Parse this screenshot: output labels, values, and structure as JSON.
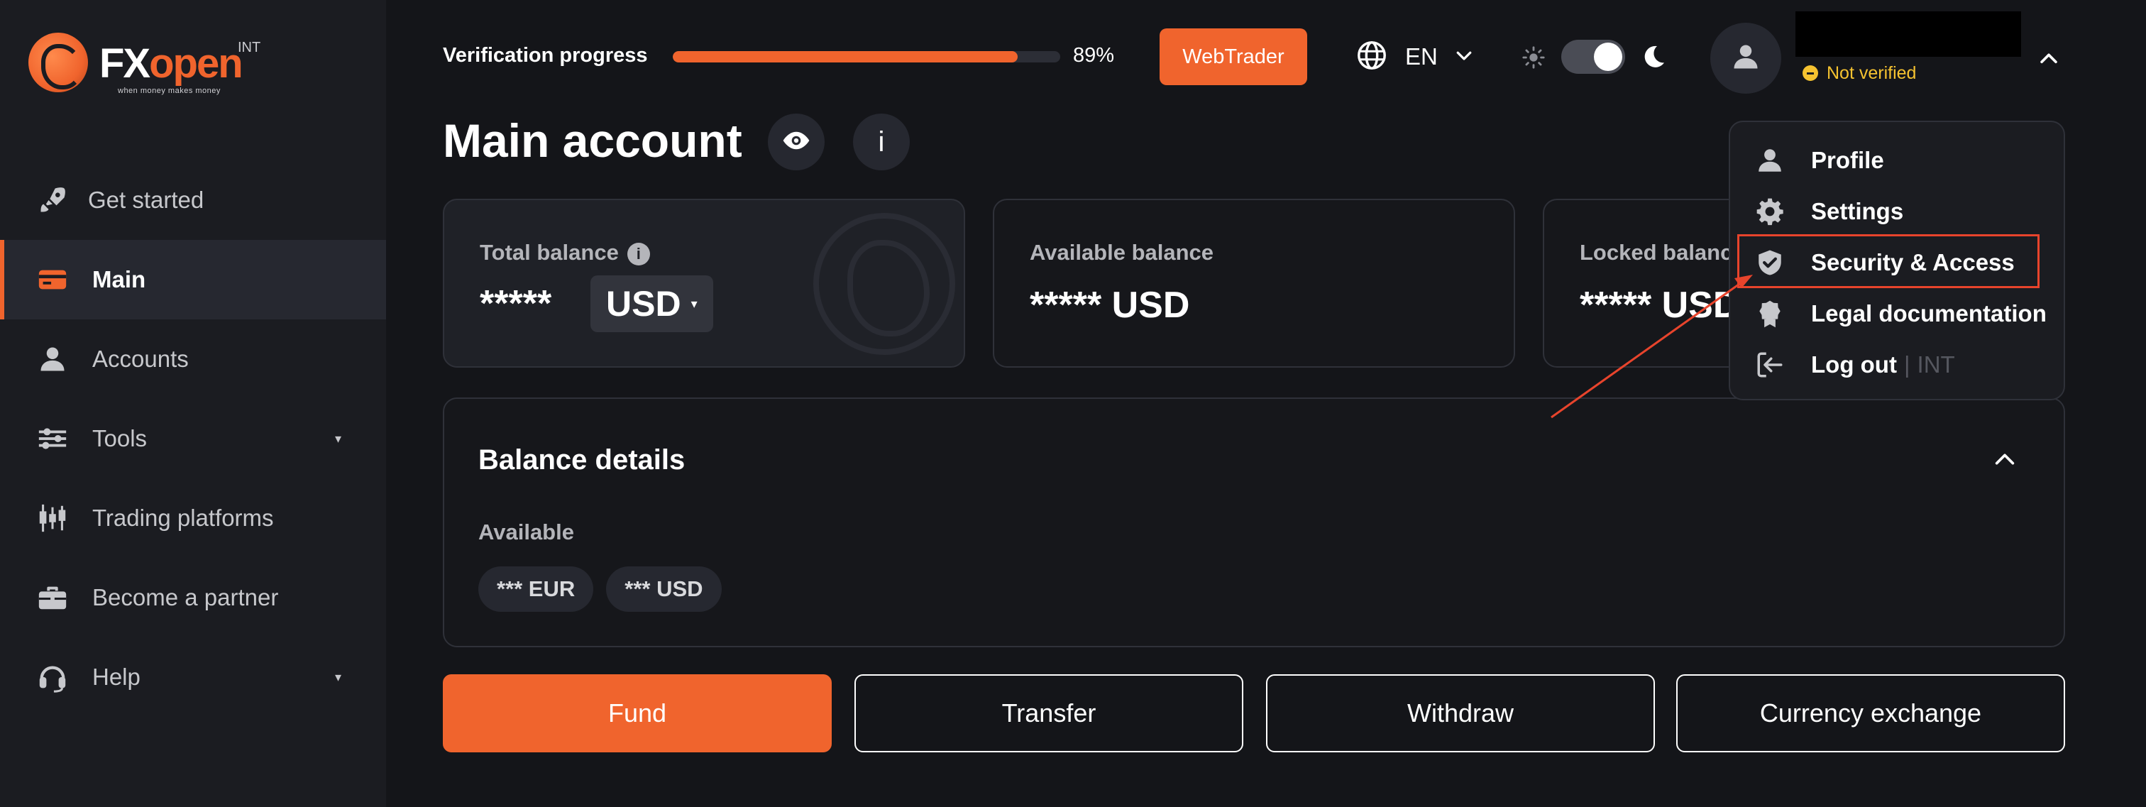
{
  "brand": {
    "logo_fx": "FX",
    "logo_open": "open",
    "logo_suffix": "INT",
    "tagline": "when money makes money"
  },
  "sidebar": {
    "items": [
      {
        "label": "Get started",
        "icon": "rocket-icon"
      },
      {
        "label": "Main",
        "icon": "card-icon",
        "active": true
      },
      {
        "label": "Accounts",
        "icon": "person-icon"
      },
      {
        "label": "Tools",
        "icon": "sliders-icon",
        "caret": "▾"
      },
      {
        "label": "Trading platforms",
        "icon": "candlestick-icon"
      },
      {
        "label": "Become a partner",
        "icon": "briefcase-icon"
      },
      {
        "label": "Help",
        "icon": "headset-icon",
        "caret": "▾"
      }
    ]
  },
  "header": {
    "verification_label": "Verification progress",
    "verification_progress": 0.89,
    "verification_percent": "89%",
    "webtrader_label": "WebTrader",
    "language": "EN",
    "theme": "dark",
    "user_status": "Not verified"
  },
  "main": {
    "title": "Main account",
    "info_label": "i",
    "cards": {
      "total_label": "Total balance",
      "total_value": "*****",
      "total_currency": "USD",
      "total_caret": "▾",
      "available_label": "Available balance",
      "available_value": "***** USD",
      "locked_label": "Locked balance",
      "locked_value": "***** USD"
    },
    "details": {
      "title": "Balance details",
      "subtitle": "Available",
      "chips": [
        "*** EUR",
        "*** USD"
      ]
    },
    "actions": {
      "fund": "Fund",
      "transfer": "Transfer",
      "withdraw": "Withdraw",
      "exchange": "Currency exchange"
    }
  },
  "user_menu": {
    "items": [
      {
        "label": "Profile",
        "icon": "person-icon"
      },
      {
        "label": "Settings",
        "icon": "gear-icon"
      },
      {
        "label": "Security & Access",
        "icon": "shield-icon",
        "highlighted": true
      },
      {
        "label": "Legal documentation",
        "icon": "certificate-icon"
      },
      {
        "label": "Log out",
        "icon": "logout-icon",
        "separator": "|",
        "suffix": "INT"
      }
    ]
  },
  "colors": {
    "accent": "#f0642d",
    "background": "#141519",
    "sidebar": "#1b1c21",
    "warning": "#f5c230",
    "annotation": "#e8442c"
  }
}
